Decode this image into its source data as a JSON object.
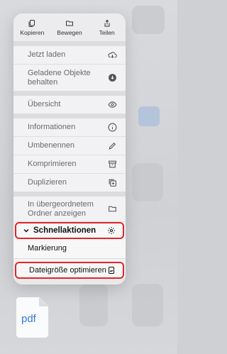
{
  "top_actions": [
    {
      "label": "Kopieren",
      "icon": "copy-icon"
    },
    {
      "label": "Bewegen",
      "icon": "folder-icon"
    },
    {
      "label": "Teilen",
      "icon": "share-icon"
    }
  ],
  "menu": {
    "group1": [
      {
        "label": "Jetzt laden",
        "icon": "cloud-download-icon"
      },
      {
        "label": "Geladene Objekte behalten",
        "icon": "arrow-down-circle-icon"
      }
    ],
    "group2": [
      {
        "label": "Übersicht",
        "icon": "eye-icon"
      }
    ],
    "group3": [
      {
        "label": "Informationen",
        "icon": "info-icon"
      },
      {
        "label": "Umbenennen",
        "icon": "pencil-icon"
      },
      {
        "label": "Komprimieren",
        "icon": "archive-box-icon"
      },
      {
        "label": "Duplizieren",
        "icon": "plus-square-icon"
      }
    ],
    "group4": [
      {
        "label": "In übergeordnetem Ordner anzeigen",
        "icon": "folder-icon"
      }
    ],
    "schnellaktionen": {
      "label": "Schnellaktionen",
      "icon": "gear-icon"
    },
    "markierung": {
      "label": "Markierung",
      "icon": "markup-icon"
    },
    "dateigroesse": {
      "label": "Dateigröße optimieren",
      "icon": "image-doc-icon"
    }
  },
  "file": {
    "label": "pdf"
  },
  "colors": {
    "highlight": "#e0262a",
    "pdf_blue": "#2f7bd8"
  }
}
